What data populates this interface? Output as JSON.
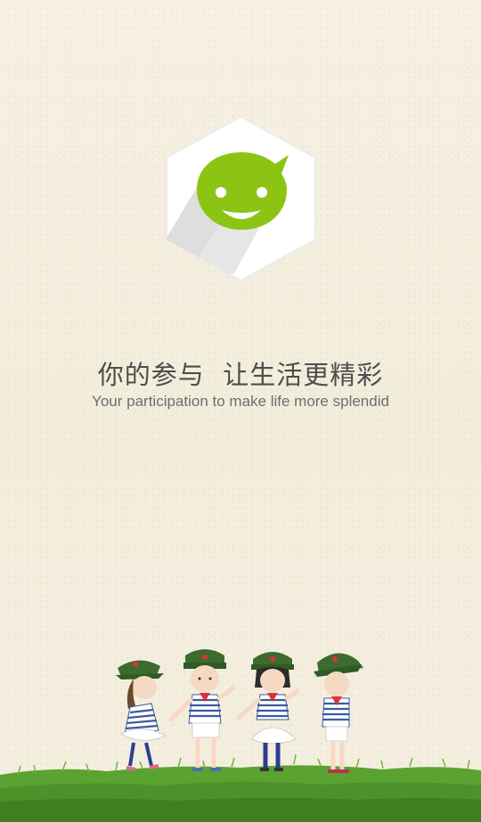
{
  "splash": {
    "app_icon": "smiley-chat-bubble-icon",
    "tagline_cn": "你的参与  让生活更精彩",
    "tagline_en": "Your participation to make life more splendid",
    "illustration": "four-children-on-grass",
    "colors": {
      "background": "#f4efdf",
      "icon_green": "#8cc414",
      "grass": "#4f9a2a",
      "text_primary": "#4d4d4d",
      "text_secondary": "#6e6e6e"
    }
  }
}
